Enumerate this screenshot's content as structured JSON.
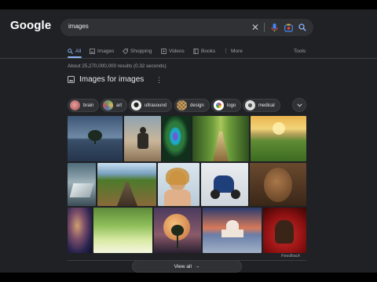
{
  "brand": {
    "logo": "Google"
  },
  "search": {
    "query": "images"
  },
  "tabs": [
    {
      "label": "All",
      "icon": "search-icon",
      "active": true
    },
    {
      "label": "Images",
      "icon": "image-icon",
      "active": false
    },
    {
      "label": "Shopping",
      "icon": "tag-icon",
      "active": false
    },
    {
      "label": "Videos",
      "icon": "play-icon",
      "active": false
    },
    {
      "label": "Books",
      "icon": "book-icon",
      "active": false
    },
    {
      "label": "More",
      "icon": "more-vert-icon",
      "active": false
    }
  ],
  "tools_label": "Tools",
  "result_stats": "About 25,270,000,000 results (0.32 seconds)",
  "section": {
    "title": "Images for images"
  },
  "chips": [
    {
      "label": "brain",
      "color": "#d88b8b"
    },
    {
      "label": "art",
      "color": "#6aa16b"
    },
    {
      "label": "ultrasound",
      "color": "#e9e9e9"
    },
    {
      "label": "design",
      "color": "#c9a36a"
    },
    {
      "label": "logo",
      "color": "#ffffff"
    },
    {
      "label": "medical",
      "color": "#d9d9d9"
    }
  ],
  "feedback_label": "Feedback",
  "view_all_label": "View all",
  "colors": {
    "background": "#202124",
    "surface": "#303134",
    "accent": "#8ab4f8"
  }
}
